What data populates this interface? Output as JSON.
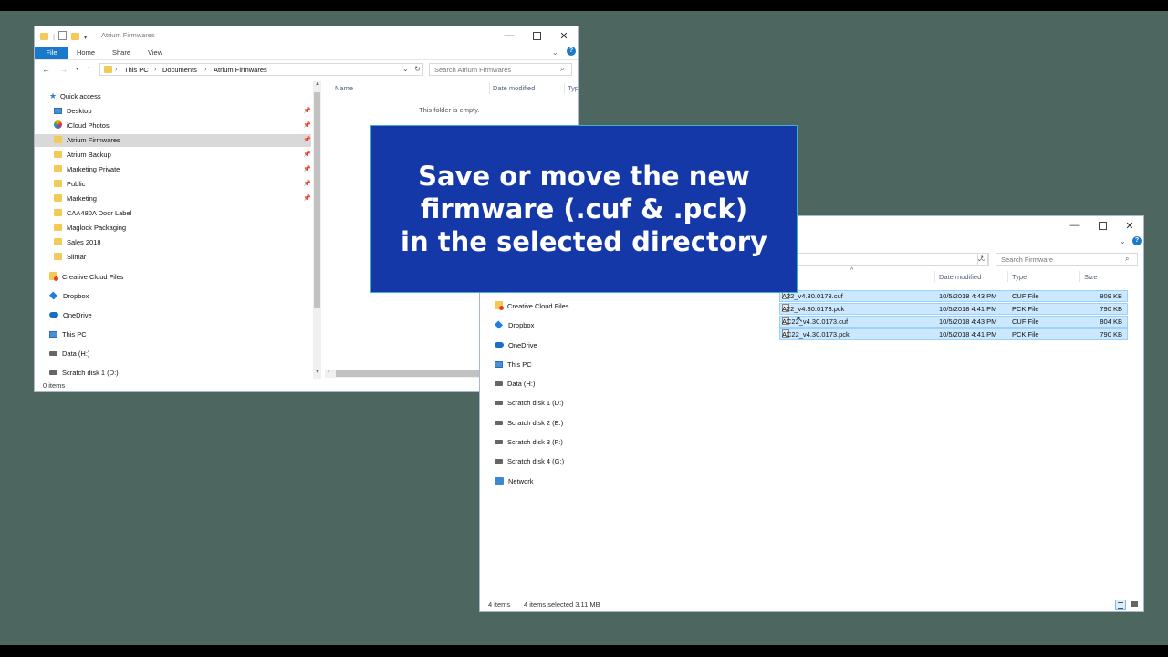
{
  "window_a": {
    "title": "Atrium Firmwares",
    "ribbon": {
      "file": "File",
      "home": "Home",
      "share": "Share",
      "view": "View"
    },
    "breadcrumb": [
      "This PC",
      "Documents",
      "Atrium Firmwares"
    ],
    "search_placeholder": "Search Atrium Firmwares",
    "nav": {
      "quick_access": "Quick access",
      "items": [
        {
          "label": "Desktop",
          "icon": "desktop-icon",
          "pinned": true
        },
        {
          "label": "iCloud Photos",
          "icon": "icloud-photos-icon",
          "pinned": true
        },
        {
          "label": "Atrium Firmwares",
          "icon": "folder-icon",
          "pinned": true,
          "selected": true
        },
        {
          "label": "Atrium Backup",
          "icon": "folder-icon",
          "pinned": true
        },
        {
          "label": "Marketing Private",
          "icon": "folder-icon",
          "pinned": true
        },
        {
          "label": "Public",
          "icon": "folder-icon",
          "pinned": true
        },
        {
          "label": "Marketing",
          "icon": "folder-icon",
          "pinned": true
        },
        {
          "label": "CAA480A Door Label",
          "icon": "folder-icon"
        },
        {
          "label": "Maglock Packaging",
          "icon": "folder-icon"
        },
        {
          "label": "Sales 2018",
          "icon": "folder-icon"
        },
        {
          "label": "Silmar",
          "icon": "folder-icon"
        }
      ],
      "creative_cloud": "Creative Cloud Files",
      "dropbox": "Dropbox",
      "onedrive": "OneDrive",
      "this_pc": "This PC",
      "data_h": "Data (H:)",
      "scratch_d": "Scratch disk 1 (D:)"
    },
    "columns": {
      "name": "Name",
      "date": "Date modified",
      "type": "Typ"
    },
    "empty_text": "This folder is empty.",
    "status": "0 items"
  },
  "window_b": {
    "search_placeholder": "Search Firmware",
    "columns": {
      "date": "Date modified",
      "type": "Type",
      "size": "Size"
    },
    "nav": {
      "creative_cloud": "Creative Cloud Files",
      "dropbox": "Dropbox",
      "onedrive": "OneDrive",
      "this_pc": "This PC",
      "data_h": "Data (H:)",
      "scratch_d": "Scratch disk 1 (D:)",
      "scratch_e": "Scratch disk 2 (E:)",
      "scratch_f": "Scratch disk 3 (F:)",
      "scratch_g": "Scratch disk 4 (G:)",
      "network": "Network"
    },
    "files": [
      {
        "name": "A22_v4.30.0173.cuf",
        "date": "10/5/2018 4:43 PM",
        "type": "CUF File",
        "size": "809 KB"
      },
      {
        "name": "A22_v4.30.0173.pck",
        "date": "10/5/2018 4:41 PM",
        "type": "PCK File",
        "size": "790 KB"
      },
      {
        "name": "AC22_v4.30.0173.cuf",
        "date": "10/5/2018 4:43 PM",
        "type": "CUF File",
        "size": "804 KB"
      },
      {
        "name": "AC22_v4.30.0173.pck",
        "date": "10/5/2018 4:41 PM",
        "type": "PCK File",
        "size": "790 KB"
      }
    ],
    "status_items": "4 items",
    "status_selected": "4 items selected  3.11 MB"
  },
  "banner": {
    "line1": "Save or move the new",
    "line2": "firmware (.cuf & .pck)",
    "line3": "in the selected directory"
  },
  "colors": {
    "desktop": "#4d6660",
    "banner": "#1438a8",
    "selection": "#cce8ff",
    "file_tab": "#1979ca"
  }
}
